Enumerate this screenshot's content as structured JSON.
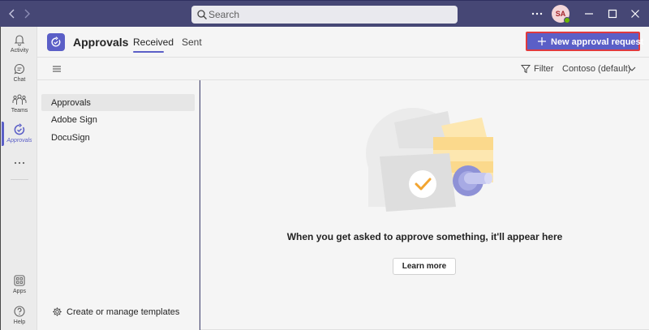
{
  "titlebar": {
    "search_placeholder": "Search",
    "avatar_initials": "SA"
  },
  "rail": {
    "items": [
      {
        "label": "Activity",
        "icon": "bell-icon"
      },
      {
        "label": "Chat",
        "icon": "chat-icon"
      },
      {
        "label": "Teams",
        "icon": "teams-icon"
      },
      {
        "label": "Approvals",
        "icon": "approvals-icon",
        "active": true
      },
      {
        "label": "Apps",
        "icon": "apps-icon"
      },
      {
        "label": "Help",
        "icon": "help-icon"
      }
    ]
  },
  "app": {
    "title": "Approvals",
    "tabs": [
      {
        "label": "Received",
        "selected": true
      },
      {
        "label": "Sent",
        "selected": false
      }
    ],
    "new_button_label": "New approval request"
  },
  "toolbar": {
    "filter_label": "Filter",
    "org_label": "Contoso (default)"
  },
  "side_panel": {
    "items": [
      {
        "label": "Approvals",
        "selected": true
      },
      {
        "label": "Adobe Sign",
        "selected": false
      },
      {
        "label": "DocuSign",
        "selected": false
      }
    ],
    "templates_label": "Create or manage templates"
  },
  "main": {
    "empty_message": "When you get asked to approve something, it'll appear here",
    "learn_more_label": "Learn more"
  },
  "colors": {
    "titlebar": "#464775",
    "accent": "#5b5fc7",
    "highlight_border": "#e03a3e",
    "panel_bg": "#f5f5f5"
  }
}
